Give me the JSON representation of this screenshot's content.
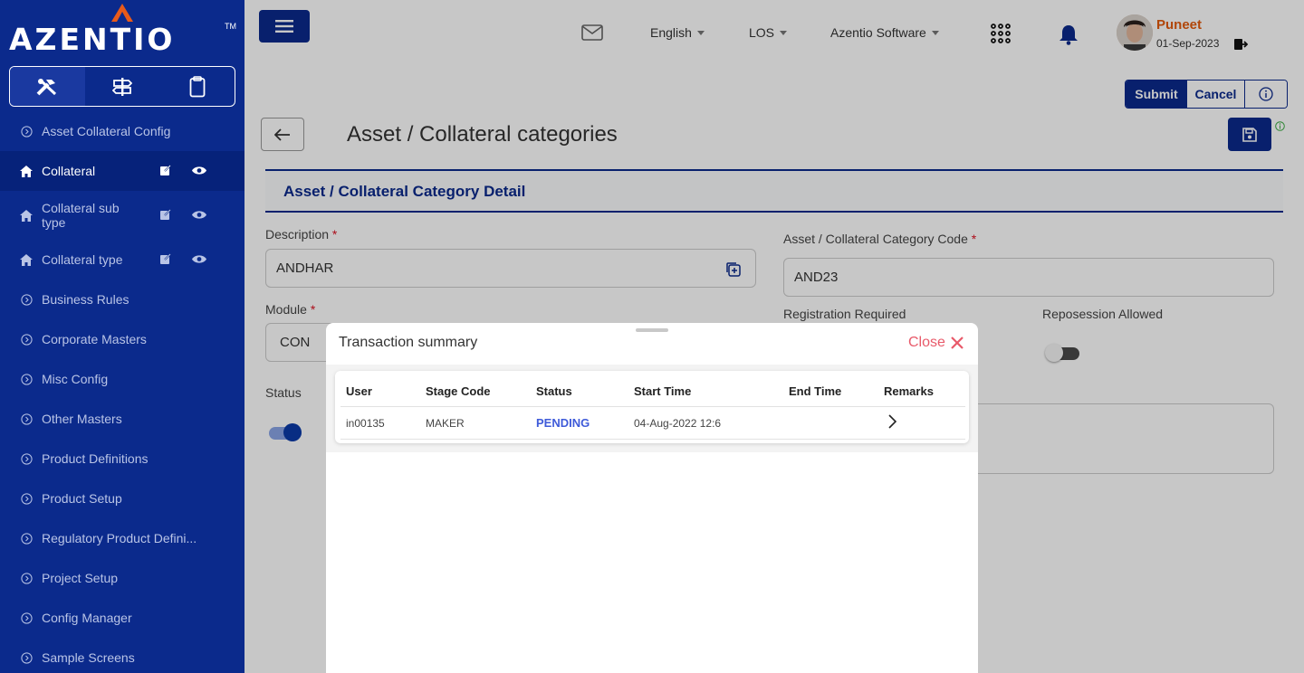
{
  "brand": {
    "logo_text": "AZENTIO",
    "tm": "TM"
  },
  "sidebar": {
    "items": [
      {
        "label": "Asset Collateral Config"
      },
      {
        "label": "Collateral"
      },
      {
        "label": "Collateral sub type"
      },
      {
        "label": "Collateral type"
      },
      {
        "label": "Business Rules"
      },
      {
        "label": "Corporate Masters"
      },
      {
        "label": "Misc Config"
      },
      {
        "label": "Other Masters"
      },
      {
        "label": "Product Definitions"
      },
      {
        "label": "Product Setup"
      },
      {
        "label": "Regulatory Product Defini..."
      },
      {
        "label": "Project Setup"
      },
      {
        "label": "Config Manager"
      },
      {
        "label": "Sample Screens"
      }
    ]
  },
  "header": {
    "language": "English",
    "module": "LOS",
    "company": "Azentio Software",
    "user_name": "Puneet",
    "user_date": "01-Sep-2023"
  },
  "actions": {
    "submit": "Submit",
    "cancel": "Cancel"
  },
  "page": {
    "title": "Asset / Collateral categories",
    "section_title": "Asset / Collateral Category Detail"
  },
  "form": {
    "description_label": "Description",
    "description_value": "ANDHAR",
    "code_label": "Asset / Collateral Category Code",
    "code_value": "AND23",
    "module_label": "Module",
    "module_value": "CON",
    "registration_label": "Registration Required",
    "repossession_label": "Reposession Allowed",
    "status_label": "Status",
    "required_mark": "*",
    "status_on": true,
    "repossession_on": false
  },
  "modal": {
    "title": "Transaction summary",
    "close_label": "Close",
    "columns": [
      "User",
      "Stage Code",
      "Status",
      "Start Time",
      "End Time",
      "Remarks"
    ],
    "rows": [
      {
        "user": "in00135",
        "stage_code": "MAKER",
        "status": "PENDING",
        "start_time": "04-Aug-2022 12:6",
        "end_time": "",
        "remarks": ""
      }
    ]
  },
  "colors": {
    "brand_navy": "#0b2a8c",
    "user_orange": "#e35a0c",
    "close_red": "#e85a6a",
    "pending_blue": "#3f5bd9"
  }
}
